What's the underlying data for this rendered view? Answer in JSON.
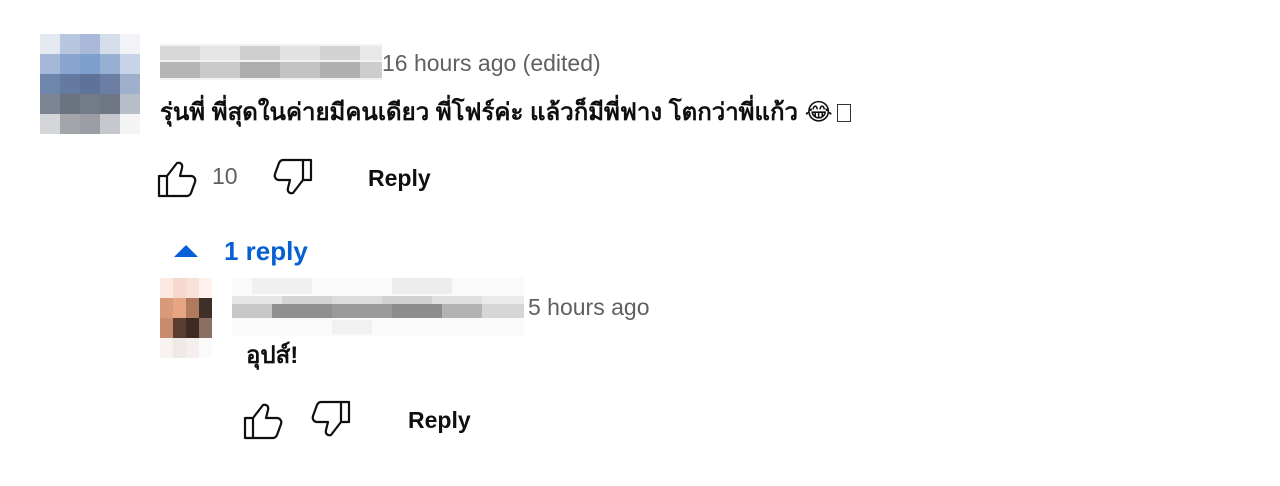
{
  "comment": {
    "timestamp": "16 hours ago (edited)",
    "text": "รุ่นพี่ พี่สุดในค่ายมีคนเดียว พี่โฟร์ค่ะ แล้วก็มีพี่ฟาง โตกว่าพี่แก้ว",
    "emoji": "😂",
    "like_count": "10",
    "reply_label": "Reply",
    "replies_toggle_label": "1 reply"
  },
  "reply": {
    "timestamp": "5 hours ago",
    "text": "อุปส์!",
    "reply_label": "Reply"
  },
  "colors": {
    "link_blue": "#065fd4",
    "secondary_text": "#606060",
    "primary_text": "#0f0f0f"
  },
  "icons": [
    "like-icon",
    "dislike-icon",
    "caret-up-icon"
  ]
}
